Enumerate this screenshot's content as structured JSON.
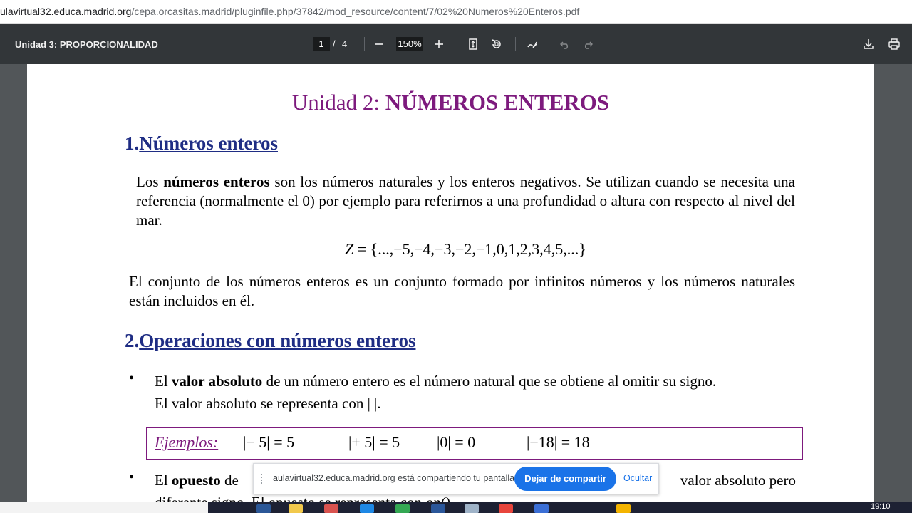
{
  "browser": {
    "url_host": "ulavirtual32.educa.madrid.org",
    "url_path": "/cepa.orcasitas.madrid/pluginfile.php/37842/mod_resource/content/7/02%20Numeros%20Enteros.pdf"
  },
  "pdf_toolbar": {
    "title": "Unidad 3: PROPORCIONALIDAD",
    "current_page": "1",
    "separator": "/",
    "total_pages": "4",
    "zoom": "150%"
  },
  "document": {
    "title_prefix": "Unidad 2: ",
    "title_bold": "NÚMEROS ENTEROS",
    "section1": {
      "number": "1.",
      "title": "Números enteros"
    },
    "para1": {
      "pre": "Los ",
      "bold": "números enteros",
      "post": " son los números naturales y los enteros negativos. Se utilizan cuando se necesita una referencia (normalmente el 0) por ejemplo para referirnos a una profundidad o altura con respecto al nivel del mar."
    },
    "formula": {
      "var": "Z",
      "rest": " = {...,−5,−4,−3,−2,−1,0,1,2,3,4,5,...}"
    },
    "para2": "El conjunto de los números enteros es un conjunto formado por infinitos números y los números naturales están incluidos en él.",
    "section2": {
      "number": "2.",
      "title": "Operaciones con números enteros"
    },
    "bullet1": {
      "pre": "El ",
      "bold": "valor absoluto",
      "post": " de un número entero es el número natural que se obtiene al omitir su signo.",
      "line2": "El valor absoluto se representa con | |."
    },
    "examples": {
      "label": "Ejemplos:",
      "items": [
        "|− 5| = 5",
        "|+ 5| = 5",
        "|0| = 0",
        "|−18| = 18"
      ]
    },
    "bullet2": {
      "pre": "El ",
      "bold": "opuesto",
      "post": " de",
      "tail": "valor absoluto pero",
      "line2_pre": "diferente signo. El opuesto se representa con ",
      "line2_italic": "op(",
      "line2_post": ")."
    }
  },
  "share_bar": {
    "text": "aulavirtual32.educa.madrid.org está compartiendo tu pantalla.",
    "stop_label": "Dejar de compartir",
    "hide_label": "Ocultar"
  },
  "taskbar": {
    "clock": "19:10"
  }
}
